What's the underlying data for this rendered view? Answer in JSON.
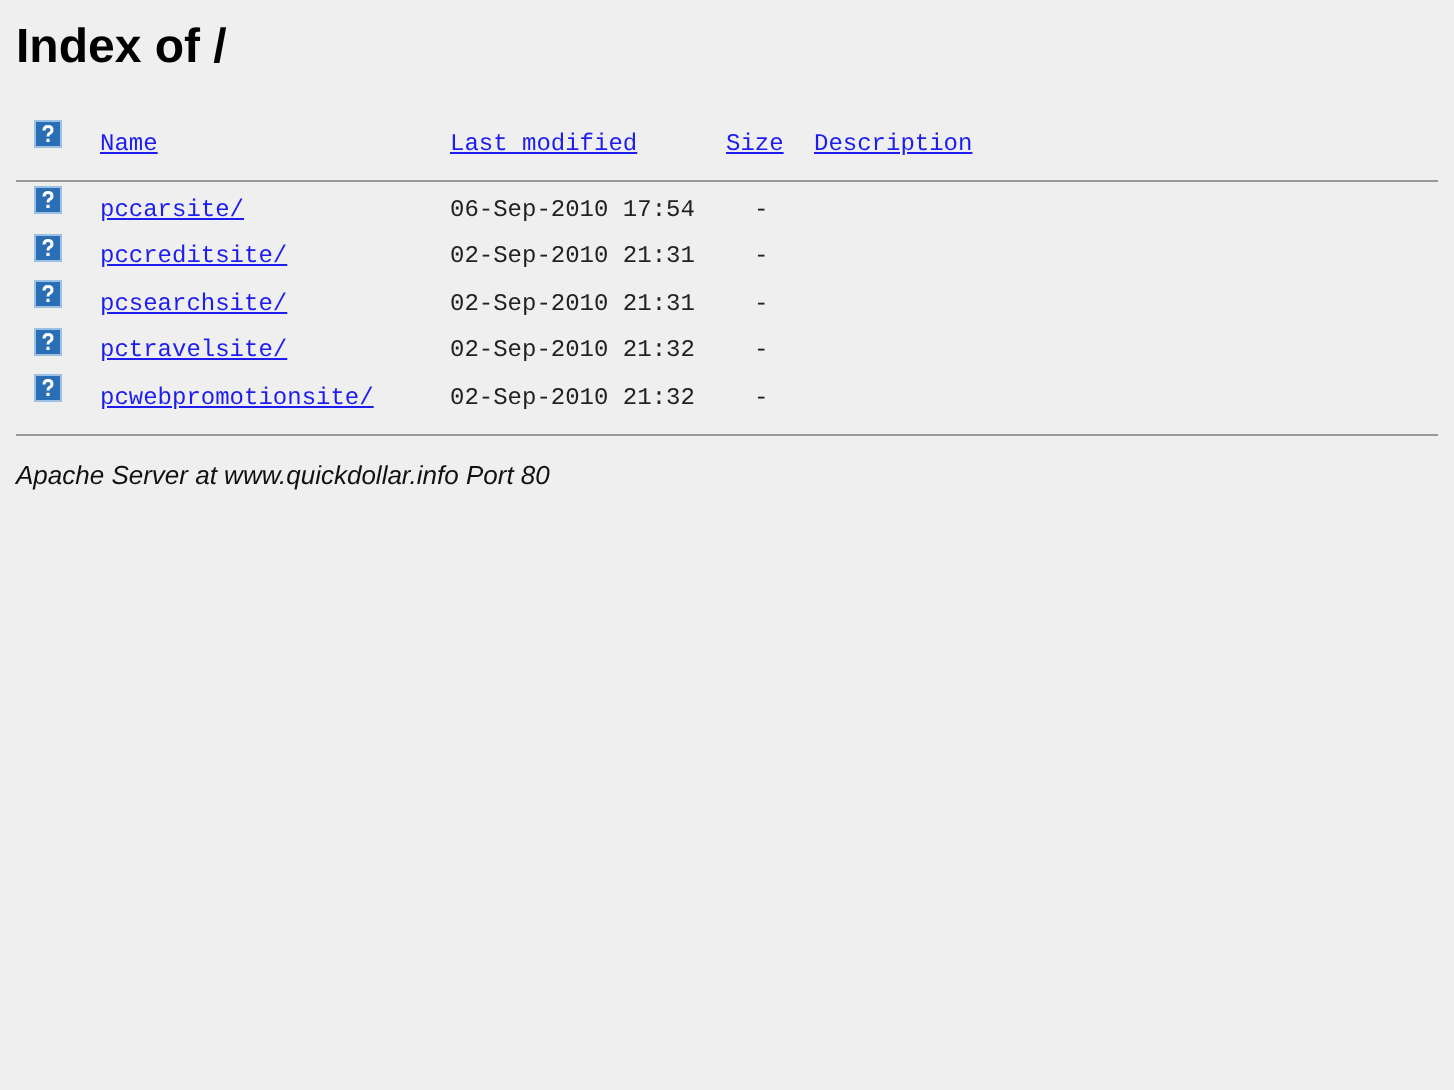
{
  "title": "Index of /",
  "columns": [
    "Name",
    "Last modified",
    "Size",
    "Description"
  ],
  "rows": [
    {
      "name": "pccarsite/",
      "modified": "06-Sep-2010 17:54",
      "size": "-"
    },
    {
      "name": "pccreditsite/",
      "modified": "02-Sep-2010 21:31",
      "size": "-"
    },
    {
      "name": "pcsearchsite/",
      "modified": "02-Sep-2010 21:31",
      "size": "-"
    },
    {
      "name": "pctravelsite/",
      "modified": "02-Sep-2010 21:32",
      "size": "-"
    },
    {
      "name": "pcwebpromotionsite/",
      "modified": "02-Sep-2010 21:32",
      "size": "-"
    }
  ],
  "footer": "Apache Server at www.quickdollar.info Port 80"
}
